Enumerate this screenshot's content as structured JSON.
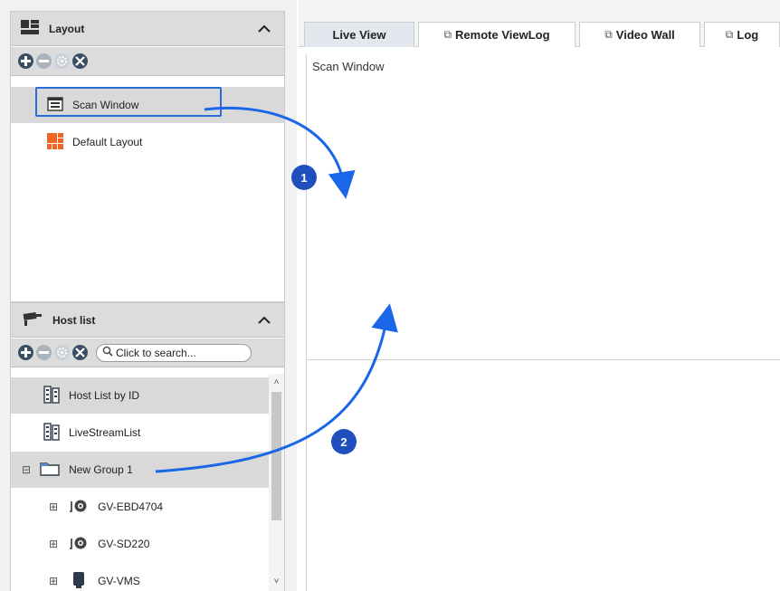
{
  "layout_panel": {
    "title": "Layout",
    "icon": "grid-layout-icon",
    "items": [
      {
        "label": "Scan Window",
        "icon": "scan-window-icon"
      },
      {
        "label": "Default Layout",
        "icon": "default-layout-icon"
      }
    ]
  },
  "host_panel": {
    "title": "Host list",
    "icon": "camera-icon",
    "search_placeholder": "Click to search...",
    "items": [
      {
        "label": "Host List by ID",
        "icon": "host-list-icon"
      },
      {
        "label": "LiveStreamList",
        "icon": "host-list-icon"
      },
      {
        "label": "New Group 1",
        "icon": "folder-icon",
        "expander": "⊟"
      },
      {
        "label": "GV-EBD4704",
        "icon": "camera-device-icon",
        "expander": "⊞"
      },
      {
        "label": "GV-SD220",
        "icon": "camera-device-icon",
        "expander": "⊞"
      },
      {
        "label": "GV-VMS",
        "icon": "server-icon",
        "expander": "⊞"
      }
    ]
  },
  "toolbar": {
    "icons": [
      "add-icon",
      "remove-icon",
      "settings-icon",
      "tools-icon"
    ]
  },
  "tabs": [
    {
      "label": "Live View",
      "external": false
    },
    {
      "label": "Remote ViewLog",
      "external": true
    },
    {
      "label": "Video Wall",
      "external": true
    },
    {
      "label": "Log",
      "external": true
    }
  ],
  "external_glyph": "⧉",
  "view": {
    "label": "Scan Window"
  },
  "annotations": [
    {
      "number": "1"
    },
    {
      "number": "2"
    }
  ],
  "colors": {
    "accent": "#2d6bd6",
    "arrow": "#1a66e8",
    "badge": "#1f4fbd",
    "selected_row": "#d9d9d9",
    "header": "#dcdcdc"
  }
}
